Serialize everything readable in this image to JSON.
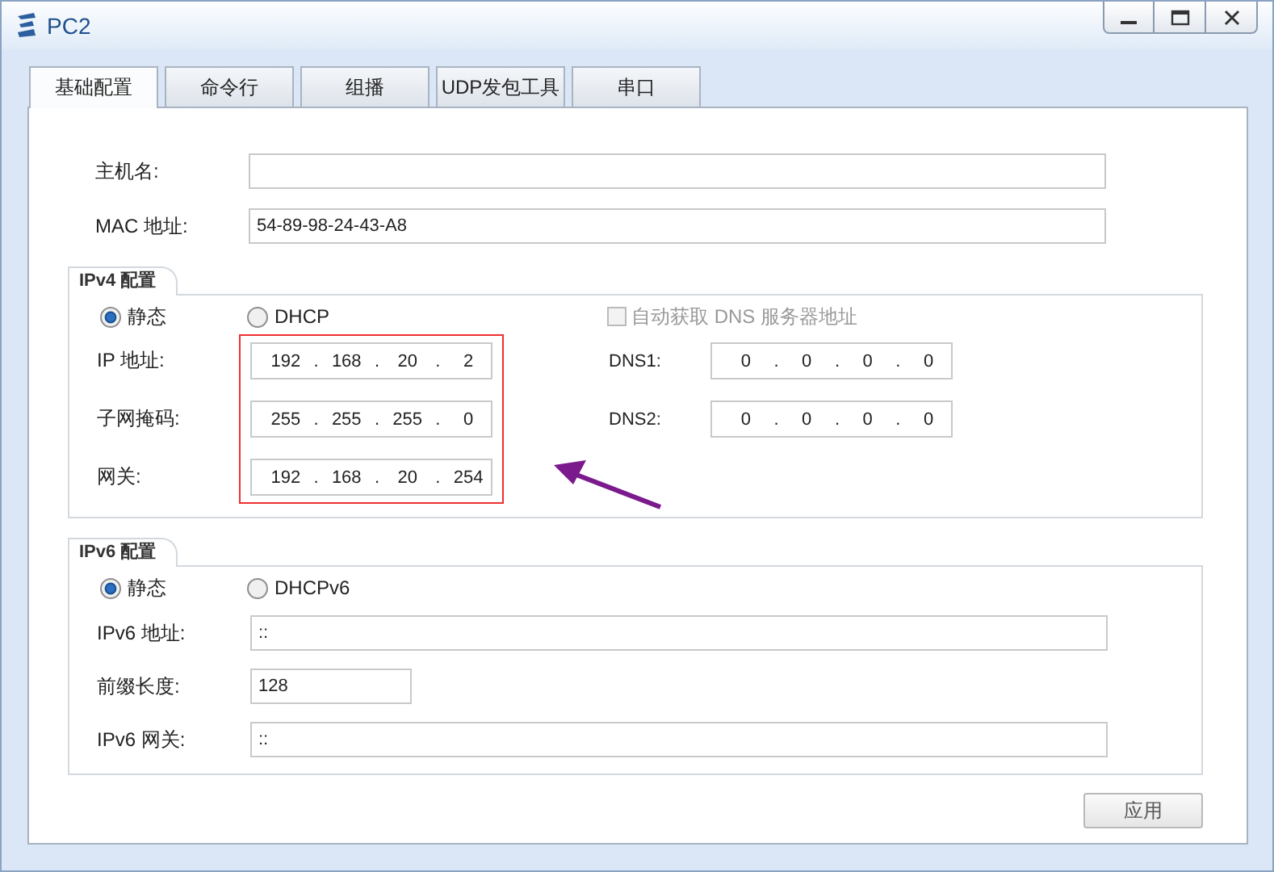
{
  "window": {
    "title": "PC2"
  },
  "tabs": [
    {
      "label": "基础配置",
      "selected": true
    },
    {
      "label": "命令行",
      "selected": false
    },
    {
      "label": "组播",
      "selected": false
    },
    {
      "label": "UDP发包工具",
      "selected": false
    },
    {
      "label": "串口",
      "selected": false
    }
  ],
  "hostname": {
    "label": "主机名:"
  },
  "mac": {
    "label": "MAC 地址:",
    "value": "54-89-98-24-43-A8"
  },
  "ipv4": {
    "title": "IPv4 配置",
    "modes": [
      {
        "label": "静态",
        "selected": true
      },
      {
        "label": "DHCP",
        "selected": false
      }
    ],
    "auto_dns": {
      "label": "自动获取 DNS 服务器地址",
      "checked": false,
      "disabled": true
    },
    "fields": [
      {
        "label": "IP 地址:",
        "parts": [
          "192",
          ".",
          "168",
          ".",
          "20",
          ".",
          "2"
        ]
      },
      {
        "label": "子网掩码:",
        "parts": [
          "255",
          ".",
          "255",
          ".",
          "255",
          ".",
          "0"
        ]
      },
      {
        "label": "网关:",
        "parts": [
          "192",
          ".",
          "168",
          ".",
          "20",
          ".",
          "254"
        ]
      }
    ],
    "dns": [
      {
        "label": "DNS1:",
        "parts": [
          "0",
          ".",
          "0",
          ".",
          "0",
          ".",
          "0"
        ]
      },
      {
        "label": "DNS2:",
        "parts": [
          "0",
          ".",
          "0",
          ".",
          "0",
          ".",
          "0"
        ]
      }
    ]
  },
  "ipv6": {
    "title": "IPv6 配置",
    "modes": [
      {
        "label": "静态",
        "selected": true
      },
      {
        "label": "DHCPv6",
        "selected": false
      }
    ],
    "address": {
      "label": "IPv6 地址:",
      "value": "::"
    },
    "prefix": {
      "label": "前缀长度:",
      "value": "128"
    },
    "gateway": {
      "label": "IPv6 网关:",
      "value": "::"
    }
  },
  "apply_button": "应用"
}
